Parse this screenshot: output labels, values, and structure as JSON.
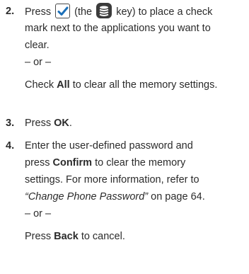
{
  "steps": [
    {
      "number": "2.",
      "line1_a": "Press",
      "line1_b": "(the",
      "line1_c": "key) to place a check",
      "line2": "mark next to the applications you want to",
      "line3": "clear.",
      "or1": "– or –",
      "alt_a": "Check",
      "alt_bold": "All",
      "alt_b": "to clear all the memory settings.",
      "icon_check": "checkmark-box-icon",
      "icon_key": "soft-key-icon"
    },
    {
      "number": "3.",
      "text_a": "Press",
      "text_bold": "OK",
      "text_b": "."
    },
    {
      "number": "4.",
      "line1": "Enter the user-defined password and",
      "line2_a": "press",
      "line2_bold": "Confirm",
      "line2_b": "to clear the memory",
      "line3": "settings. For more information, refer to",
      "line4_italic": "“Change Phone Password”",
      "line4_b": " on page 64.",
      "or2": "– or –",
      "alt_a": "Press",
      "alt_bold": "Back",
      "alt_b": "to cancel."
    }
  ],
  "colors": {
    "text": "#2b2b2b",
    "icon_dark": "#3b3b3b",
    "check_blue": "#1b6fb8"
  }
}
